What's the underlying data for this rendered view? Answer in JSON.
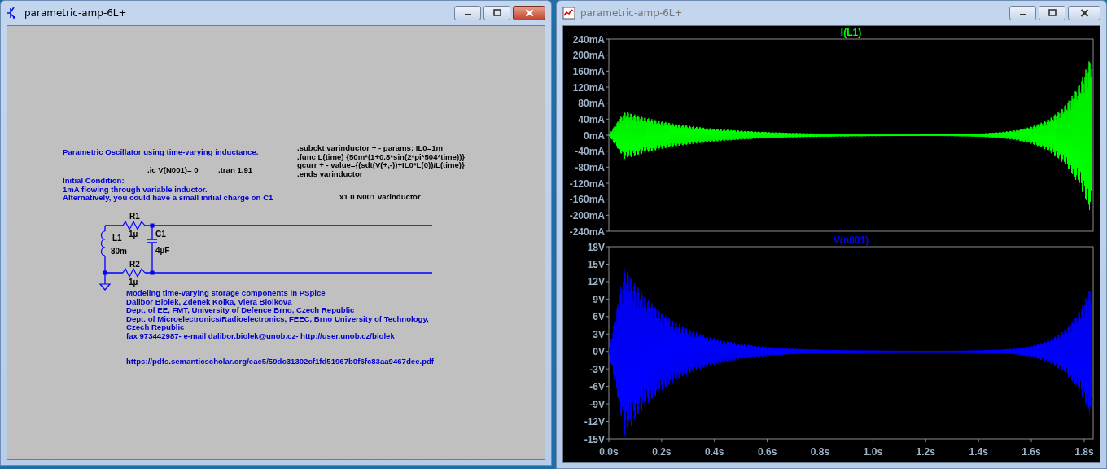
{
  "windows": [
    {
      "kind": "schematic",
      "title": "parametric-amp-6L+",
      "active": true,
      "texts": [
        {
          "kind": "comment",
          "lines": [
            "Parametric Oscillator using time-varying inductance."
          ]
        },
        {
          "kind": "directive",
          "lines": [
            ".ic V(N001)= 0"
          ]
        },
        {
          "kind": "directive",
          "lines": [
            ".tran 1.91"
          ]
        },
        {
          "kind": "comment",
          "lines": [
            "Initial Condition:",
            "1mA flowing through variable inductor.",
            "Alternatively, you could have a small initial charge on C1"
          ]
        },
        {
          "kind": "directive",
          "lines": [
            ".subckt varinductor + - params: IL0=1m",
            ".func L(time) {50m*(1+0.8*sin(2*pi*504*time))}",
            "gcurr + - value={(sdt(V(+,-))+IL0*L(0))/L(time)}",
            ".ends varinductor"
          ]
        },
        {
          "kind": "directive",
          "lines": [
            "x1 0  N001 varinductor"
          ]
        },
        {
          "kind": "comment",
          "lines": [
            "Modeling time-varying storage components in PSpice",
            "Dalibor Biolek, Zdenek Kolka, Viera Biolkova",
            "Dept. of EE, FMT, University of Defence Brno, Czech Republic",
            "Dept. of Microelectronics/Radioelectronics, FEEC, Brno University of Technology,",
            "Czech Republic",
            "fax 973442987- e-mail dalibor.biolek@unob.cz- http://user.unob.cz/biolek"
          ]
        },
        {
          "kind": "comment",
          "lines": [
            "https://pdfs.semanticscholar.org/eae5/59dc31302cf1fd51967b0f6fc83aa9467dee.pdf"
          ]
        }
      ],
      "parts": [
        {
          "ref": "R1",
          "value": "1µ"
        },
        {
          "ref": "L1",
          "value": "80m"
        },
        {
          "ref": "C1",
          "value": "4µF"
        },
        {
          "ref": "R2",
          "value": "1µ"
        }
      ]
    },
    {
      "kind": "waveform",
      "title": "parametric-amp-6L+",
      "active": false,
      "plots": [
        {
          "trace": "I(L1)",
          "color": "#00ff00",
          "yticks": [
            "240mA",
            "200mA",
            "160mA",
            "120mA",
            "80mA",
            "40mA",
            "0mA",
            "-40mA",
            "-80mA",
            "-120mA",
            "-160mA",
            "-200mA",
            "-240mA"
          ]
        },
        {
          "trace": "V(n001)",
          "color": "#0000ff",
          "yticks": [
            "18V",
            "15V",
            "12V",
            "9V",
            "6V",
            "3V",
            "0V",
            "-3V",
            "-6V",
            "-9V",
            "-12V",
            "-15V"
          ]
        }
      ],
      "xticks": [
        "0.0s",
        "0.2s",
        "0.4s",
        "0.6s",
        "0.8s",
        "1.0s",
        "1.2s",
        "1.4s",
        "1.6s",
        "1.8s"
      ]
    }
  ]
}
